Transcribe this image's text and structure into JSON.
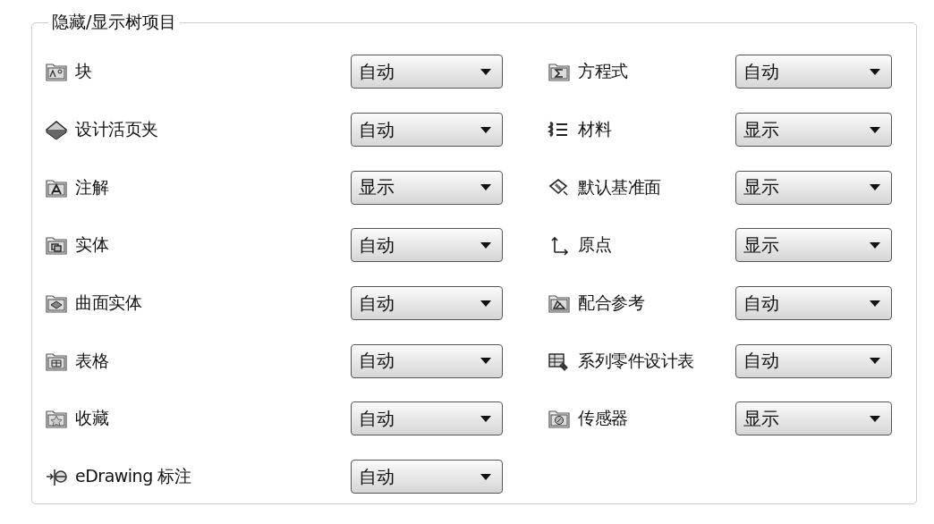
{
  "group": {
    "title": "隐藏/显示树项目"
  },
  "left_column": [
    {
      "label": "块",
      "value": "自动"
    },
    {
      "label": "设计活页夹",
      "value": "自动"
    },
    {
      "label": "注解",
      "value": "显示"
    },
    {
      "label": "实体",
      "value": "自动"
    },
    {
      "label": "曲面实体",
      "value": "自动"
    },
    {
      "label": "表格",
      "value": "自动"
    },
    {
      "label": "收藏",
      "value": "自动"
    },
    {
      "label": "eDrawing 标注",
      "value": "自动"
    }
  ],
  "right_column": [
    {
      "label": "方程式",
      "value": "自动"
    },
    {
      "label": "材料",
      "value": "显示"
    },
    {
      "label": "默认基准面",
      "value": "显示"
    },
    {
      "label": "原点",
      "value": "显示"
    },
    {
      "label": "配合参考",
      "value": "自动"
    },
    {
      "label": "系列零件设计表",
      "value": "自动"
    },
    {
      "label": "传感器",
      "value": "显示"
    }
  ]
}
